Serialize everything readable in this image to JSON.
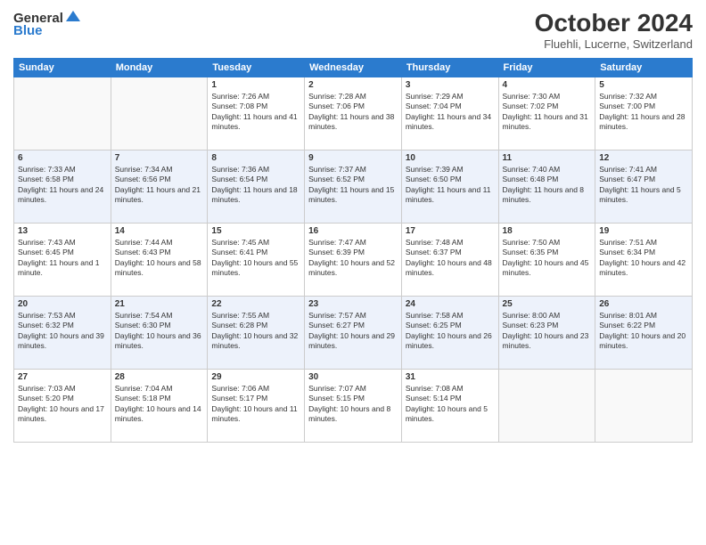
{
  "header": {
    "logo_general": "General",
    "logo_blue": "Blue",
    "month_title": "October 2024",
    "location": "Fluehli, Lucerne, Switzerland"
  },
  "days_of_week": [
    "Sunday",
    "Monday",
    "Tuesday",
    "Wednesday",
    "Thursday",
    "Friday",
    "Saturday"
  ],
  "weeks": [
    [
      {
        "day": "",
        "sunrise": "",
        "sunset": "",
        "daylight": ""
      },
      {
        "day": "",
        "sunrise": "",
        "sunset": "",
        "daylight": ""
      },
      {
        "day": "1",
        "sunrise": "Sunrise: 7:26 AM",
        "sunset": "Sunset: 7:08 PM",
        "daylight": "Daylight: 11 hours and 41 minutes."
      },
      {
        "day": "2",
        "sunrise": "Sunrise: 7:28 AM",
        "sunset": "Sunset: 7:06 PM",
        "daylight": "Daylight: 11 hours and 38 minutes."
      },
      {
        "day": "3",
        "sunrise": "Sunrise: 7:29 AM",
        "sunset": "Sunset: 7:04 PM",
        "daylight": "Daylight: 11 hours and 34 minutes."
      },
      {
        "day": "4",
        "sunrise": "Sunrise: 7:30 AM",
        "sunset": "Sunset: 7:02 PM",
        "daylight": "Daylight: 11 hours and 31 minutes."
      },
      {
        "day": "5",
        "sunrise": "Sunrise: 7:32 AM",
        "sunset": "Sunset: 7:00 PM",
        "daylight": "Daylight: 11 hours and 28 minutes."
      }
    ],
    [
      {
        "day": "6",
        "sunrise": "Sunrise: 7:33 AM",
        "sunset": "Sunset: 6:58 PM",
        "daylight": "Daylight: 11 hours and 24 minutes."
      },
      {
        "day": "7",
        "sunrise": "Sunrise: 7:34 AM",
        "sunset": "Sunset: 6:56 PM",
        "daylight": "Daylight: 11 hours and 21 minutes."
      },
      {
        "day": "8",
        "sunrise": "Sunrise: 7:36 AM",
        "sunset": "Sunset: 6:54 PM",
        "daylight": "Daylight: 11 hours and 18 minutes."
      },
      {
        "day": "9",
        "sunrise": "Sunrise: 7:37 AM",
        "sunset": "Sunset: 6:52 PM",
        "daylight": "Daylight: 11 hours and 15 minutes."
      },
      {
        "day": "10",
        "sunrise": "Sunrise: 7:39 AM",
        "sunset": "Sunset: 6:50 PM",
        "daylight": "Daylight: 11 hours and 11 minutes."
      },
      {
        "day": "11",
        "sunrise": "Sunrise: 7:40 AM",
        "sunset": "Sunset: 6:48 PM",
        "daylight": "Daylight: 11 hours and 8 minutes."
      },
      {
        "day": "12",
        "sunrise": "Sunrise: 7:41 AM",
        "sunset": "Sunset: 6:47 PM",
        "daylight": "Daylight: 11 hours and 5 minutes."
      }
    ],
    [
      {
        "day": "13",
        "sunrise": "Sunrise: 7:43 AM",
        "sunset": "Sunset: 6:45 PM",
        "daylight": "Daylight: 11 hours and 1 minute."
      },
      {
        "day": "14",
        "sunrise": "Sunrise: 7:44 AM",
        "sunset": "Sunset: 6:43 PM",
        "daylight": "Daylight: 10 hours and 58 minutes."
      },
      {
        "day": "15",
        "sunrise": "Sunrise: 7:45 AM",
        "sunset": "Sunset: 6:41 PM",
        "daylight": "Daylight: 10 hours and 55 minutes."
      },
      {
        "day": "16",
        "sunrise": "Sunrise: 7:47 AM",
        "sunset": "Sunset: 6:39 PM",
        "daylight": "Daylight: 10 hours and 52 minutes."
      },
      {
        "day": "17",
        "sunrise": "Sunrise: 7:48 AM",
        "sunset": "Sunset: 6:37 PM",
        "daylight": "Daylight: 10 hours and 48 minutes."
      },
      {
        "day": "18",
        "sunrise": "Sunrise: 7:50 AM",
        "sunset": "Sunset: 6:35 PM",
        "daylight": "Daylight: 10 hours and 45 minutes."
      },
      {
        "day": "19",
        "sunrise": "Sunrise: 7:51 AM",
        "sunset": "Sunset: 6:34 PM",
        "daylight": "Daylight: 10 hours and 42 minutes."
      }
    ],
    [
      {
        "day": "20",
        "sunrise": "Sunrise: 7:53 AM",
        "sunset": "Sunset: 6:32 PM",
        "daylight": "Daylight: 10 hours and 39 minutes."
      },
      {
        "day": "21",
        "sunrise": "Sunrise: 7:54 AM",
        "sunset": "Sunset: 6:30 PM",
        "daylight": "Daylight: 10 hours and 36 minutes."
      },
      {
        "day": "22",
        "sunrise": "Sunrise: 7:55 AM",
        "sunset": "Sunset: 6:28 PM",
        "daylight": "Daylight: 10 hours and 32 minutes."
      },
      {
        "day": "23",
        "sunrise": "Sunrise: 7:57 AM",
        "sunset": "Sunset: 6:27 PM",
        "daylight": "Daylight: 10 hours and 29 minutes."
      },
      {
        "day": "24",
        "sunrise": "Sunrise: 7:58 AM",
        "sunset": "Sunset: 6:25 PM",
        "daylight": "Daylight: 10 hours and 26 minutes."
      },
      {
        "day": "25",
        "sunrise": "Sunrise: 8:00 AM",
        "sunset": "Sunset: 6:23 PM",
        "daylight": "Daylight: 10 hours and 23 minutes."
      },
      {
        "day": "26",
        "sunrise": "Sunrise: 8:01 AM",
        "sunset": "Sunset: 6:22 PM",
        "daylight": "Daylight: 10 hours and 20 minutes."
      }
    ],
    [
      {
        "day": "27",
        "sunrise": "Sunrise: 7:03 AM",
        "sunset": "Sunset: 5:20 PM",
        "daylight": "Daylight: 10 hours and 17 minutes."
      },
      {
        "day": "28",
        "sunrise": "Sunrise: 7:04 AM",
        "sunset": "Sunset: 5:18 PM",
        "daylight": "Daylight: 10 hours and 14 minutes."
      },
      {
        "day": "29",
        "sunrise": "Sunrise: 7:06 AM",
        "sunset": "Sunset: 5:17 PM",
        "daylight": "Daylight: 10 hours and 11 minutes."
      },
      {
        "day": "30",
        "sunrise": "Sunrise: 7:07 AM",
        "sunset": "Sunset: 5:15 PM",
        "daylight": "Daylight: 10 hours and 8 minutes."
      },
      {
        "day": "31",
        "sunrise": "Sunrise: 7:08 AM",
        "sunset": "Sunset: 5:14 PM",
        "daylight": "Daylight: 10 hours and 5 minutes."
      },
      {
        "day": "",
        "sunrise": "",
        "sunset": "",
        "daylight": ""
      },
      {
        "day": "",
        "sunrise": "",
        "sunset": "",
        "daylight": ""
      }
    ]
  ]
}
